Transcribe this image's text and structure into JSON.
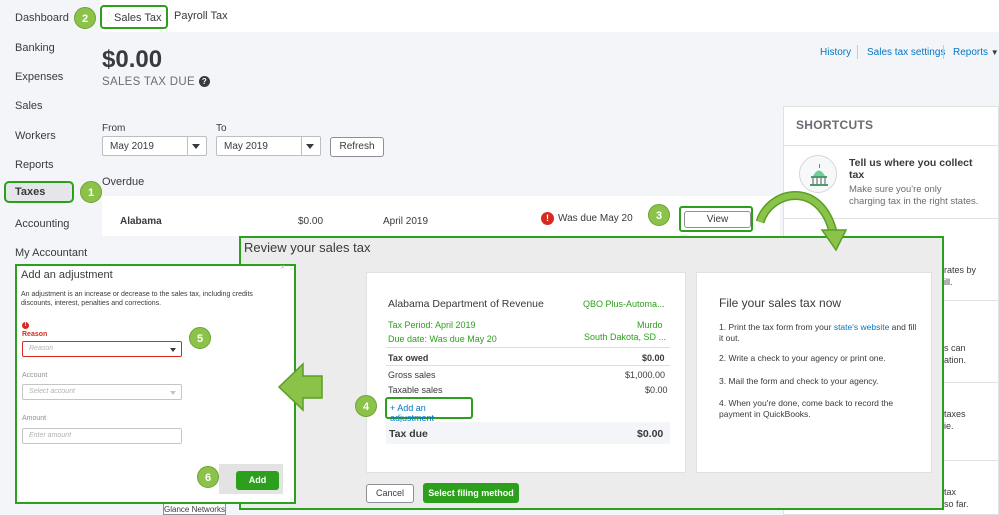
{
  "sidebar": {
    "items": [
      "Dashboard",
      "Banking",
      "Expenses",
      "Sales",
      "Workers",
      "Reports",
      "Taxes",
      "Accounting",
      "My Accountant"
    ]
  },
  "tabs": [
    "Sales Tax",
    "Payroll Tax"
  ],
  "header": {
    "amount": "$0.00",
    "amount_label": "SALES TAX DUE",
    "links": [
      "History",
      "Sales tax settings",
      "Reports"
    ]
  },
  "filters": {
    "from_label": "From",
    "from_value": "May 2019",
    "to_label": "To",
    "to_value": "May 2019",
    "refresh_label": "Refresh"
  },
  "overdue": {
    "label": "Overdue",
    "row": {
      "state": "Alabama",
      "amount": "$0.00",
      "period": "April 2019",
      "due": "Was due May 20",
      "action": "View"
    }
  },
  "shortcuts": {
    "title": "SHORTCUTS",
    "item_title": "Tell us where you collect tax",
    "item_desc": "Make sure you're only charging tax in the right states.",
    "fragments": [
      "rates by",
      "ill.",
      "s can",
      "ation.",
      "taxes",
      "ie.",
      "tax",
      "so far."
    ]
  },
  "review": {
    "title": "Review your sales tax",
    "agency": "Alabama Department of Revenue",
    "company": "QBO Plus-Automa...",
    "tax_period": "Tax Period: April 2019",
    "city": "Murdo",
    "due_date": "Due date:  Was due May 20",
    "region": "South Dakota, SD ...",
    "tax_owed_label": "Tax owed",
    "tax_owed_value": "$0.00",
    "gross_label": "Gross sales",
    "gross_value": "$1,000.00",
    "taxable_label": "Taxable sales",
    "taxable_value": "$0.00",
    "add_adjustment": "+ Add an adjustment",
    "tax_due_label": "Tax due",
    "tax_due_value": "$0.00",
    "cancel": "Cancel",
    "select_method": "Select filing method",
    "file_title": "File your sales tax now",
    "steps": [
      "1. Print the tax form from your",
      "state's website",
      "and fill it out.",
      "2. Write a check to your agency or print one.",
      "3. Mail the form and check to your agency.",
      "4. When you're done, come back to record the payment in QuickBooks."
    ]
  },
  "adjustment": {
    "title": "Add an adjustment",
    "close": "×",
    "description": "An adjustment is an increase or decrease to the sales tax, including credits discounts, interest, penalties and corrections.",
    "required_mark": "!",
    "reason_label": "Reason",
    "reason_placeholder": "Reason",
    "account_label": "Account",
    "account_placeholder": "Select account",
    "amount_label": "Amount",
    "amount_placeholder": "Enter amount",
    "add": "Add"
  },
  "glance": "Glance Networks",
  "badges": [
    "1",
    "2",
    "3",
    "4",
    "5",
    "6"
  ],
  "colors": {
    "accent": "#2ca01c",
    "link": "#0077c5",
    "badge": "#8bc34a",
    "error": "#d52b1e"
  }
}
